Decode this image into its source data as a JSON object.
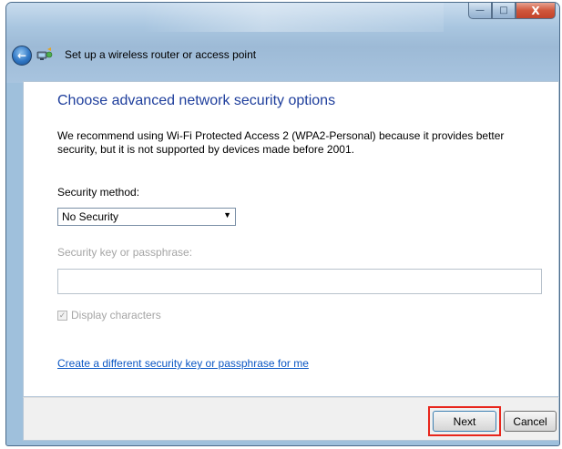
{
  "window": {
    "title": "Set up a wireless router or access point",
    "caption_buttons": {
      "minimize": "—",
      "maximize": "□",
      "close": "X"
    },
    "back_icon": "back-arrow-icon",
    "wizard_icon": "network-wizard-icon"
  },
  "main": {
    "heading": "Choose advanced network security options",
    "description": "We recommend using Wi-Fi Protected Access 2 (WPA2-Personal) because it provides better security,  but it is not supported by devices made before 2001.",
    "security_method_label": "Security method:",
    "security_method_value": "No Security",
    "dropdown_arrow": "▼",
    "key_label": "Security key or passphrase:",
    "key_value": "",
    "display_characters_label": "Display characters",
    "display_characters_checked": true,
    "create_key_link": "Create a different security key or passphrase for me"
  },
  "footer": {
    "next_label": "Next",
    "cancel_label": "Cancel",
    "highlight_color": "#e8261c"
  }
}
